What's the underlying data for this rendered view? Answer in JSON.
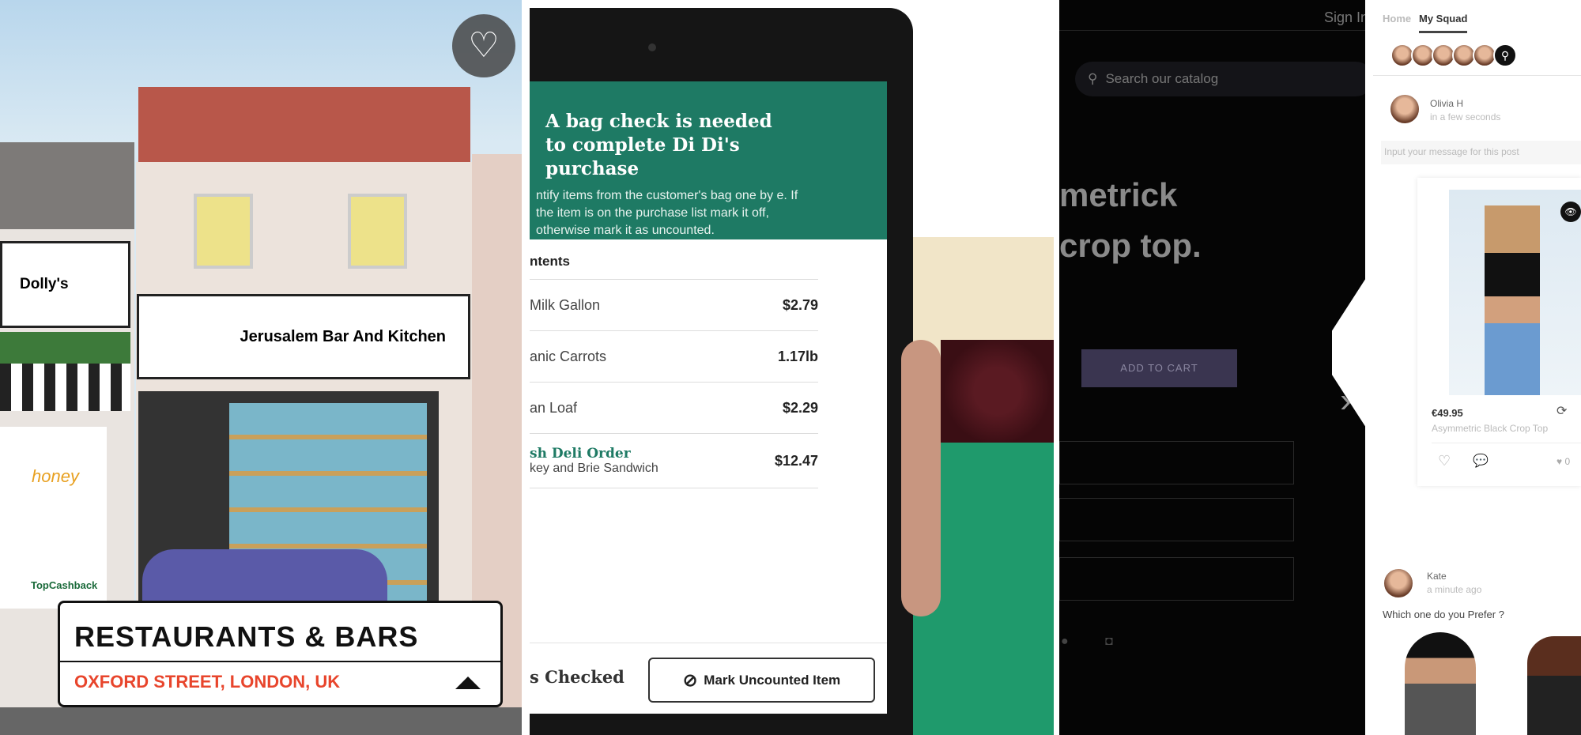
{
  "panel1": {
    "shops": [
      "Dolly's",
      "Jerusalem Bar And Kitchen",
      "honey",
      "TopCashback"
    ],
    "category_title": "RESTAURANTS & BARS",
    "location": "OXFORD STREET, LONDON, UK",
    "accent": "#e8452c",
    "icons": [
      "heart-icon",
      "triangle-up-icon"
    ]
  },
  "panel2": {
    "header_title": "A bag check is needed to complete Di Di's purchase",
    "header_body": "ntify items from the customer's bag one by e. If the item is on the purchase list mark it off, otherwise mark it as uncounted.",
    "list_title": "ntents",
    "items": [
      {
        "name": "Milk Gallon",
        "value": "$2.79"
      },
      {
        "name": "anic Carrots",
        "value": "1.17lb"
      },
      {
        "name": "an Loaf",
        "value": "$2.29"
      },
      {
        "name": "sh Deli Order",
        "sub": "key and Brie Sandwich",
        "value": "$12.47"
      }
    ],
    "footer_label": "s Checked",
    "mark_button": "Mark Uncounted Item",
    "accent": "#1e7a64"
  },
  "panel3": {
    "sign_in": "Sign In",
    "search_placeholder": "Search our catalog",
    "product_line1": "metrick",
    "product_line2": "crop top.",
    "add_to_cart": "ADD TO CART",
    "squad": {
      "tabs": [
        "Home",
        "My Squad"
      ],
      "post1": {
        "user": "Olivia H",
        "time": "in a few seconds",
        "input_placeholder": "Input your message for this post",
        "price": "€49.95",
        "product": "Asymmetric Black Crop Top",
        "likes": "0"
      },
      "post2": {
        "user": "Kate",
        "time": "a minute ago",
        "text": "Which one do you Prefer ?"
      }
    }
  }
}
